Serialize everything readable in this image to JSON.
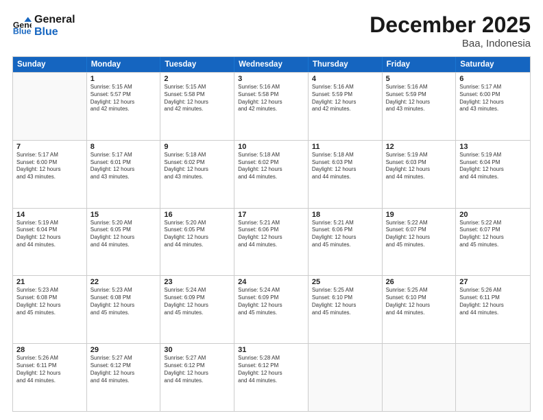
{
  "header": {
    "logo_line1": "General",
    "logo_line2": "Blue",
    "title": "December 2025",
    "subtitle": "Baa, Indonesia"
  },
  "days_of_week": [
    "Sunday",
    "Monday",
    "Tuesday",
    "Wednesday",
    "Thursday",
    "Friday",
    "Saturday"
  ],
  "weeks": [
    [
      {
        "day": "",
        "info": ""
      },
      {
        "day": "1",
        "info": "Sunrise: 5:15 AM\nSunset: 5:57 PM\nDaylight: 12 hours\nand 42 minutes."
      },
      {
        "day": "2",
        "info": "Sunrise: 5:15 AM\nSunset: 5:58 PM\nDaylight: 12 hours\nand 42 minutes."
      },
      {
        "day": "3",
        "info": "Sunrise: 5:16 AM\nSunset: 5:58 PM\nDaylight: 12 hours\nand 42 minutes."
      },
      {
        "day": "4",
        "info": "Sunrise: 5:16 AM\nSunset: 5:59 PM\nDaylight: 12 hours\nand 42 minutes."
      },
      {
        "day": "5",
        "info": "Sunrise: 5:16 AM\nSunset: 5:59 PM\nDaylight: 12 hours\nand 43 minutes."
      },
      {
        "day": "6",
        "info": "Sunrise: 5:17 AM\nSunset: 6:00 PM\nDaylight: 12 hours\nand 43 minutes."
      }
    ],
    [
      {
        "day": "7",
        "info": "Sunrise: 5:17 AM\nSunset: 6:00 PM\nDaylight: 12 hours\nand 43 minutes."
      },
      {
        "day": "8",
        "info": "Sunrise: 5:17 AM\nSunset: 6:01 PM\nDaylight: 12 hours\nand 43 minutes."
      },
      {
        "day": "9",
        "info": "Sunrise: 5:18 AM\nSunset: 6:02 PM\nDaylight: 12 hours\nand 43 minutes."
      },
      {
        "day": "10",
        "info": "Sunrise: 5:18 AM\nSunset: 6:02 PM\nDaylight: 12 hours\nand 44 minutes."
      },
      {
        "day": "11",
        "info": "Sunrise: 5:18 AM\nSunset: 6:03 PM\nDaylight: 12 hours\nand 44 minutes."
      },
      {
        "day": "12",
        "info": "Sunrise: 5:19 AM\nSunset: 6:03 PM\nDaylight: 12 hours\nand 44 minutes."
      },
      {
        "day": "13",
        "info": "Sunrise: 5:19 AM\nSunset: 6:04 PM\nDaylight: 12 hours\nand 44 minutes."
      }
    ],
    [
      {
        "day": "14",
        "info": "Sunrise: 5:19 AM\nSunset: 6:04 PM\nDaylight: 12 hours\nand 44 minutes."
      },
      {
        "day": "15",
        "info": "Sunrise: 5:20 AM\nSunset: 6:05 PM\nDaylight: 12 hours\nand 44 minutes."
      },
      {
        "day": "16",
        "info": "Sunrise: 5:20 AM\nSunset: 6:05 PM\nDaylight: 12 hours\nand 44 minutes."
      },
      {
        "day": "17",
        "info": "Sunrise: 5:21 AM\nSunset: 6:06 PM\nDaylight: 12 hours\nand 44 minutes."
      },
      {
        "day": "18",
        "info": "Sunrise: 5:21 AM\nSunset: 6:06 PM\nDaylight: 12 hours\nand 45 minutes."
      },
      {
        "day": "19",
        "info": "Sunrise: 5:22 AM\nSunset: 6:07 PM\nDaylight: 12 hours\nand 45 minutes."
      },
      {
        "day": "20",
        "info": "Sunrise: 5:22 AM\nSunset: 6:07 PM\nDaylight: 12 hours\nand 45 minutes."
      }
    ],
    [
      {
        "day": "21",
        "info": "Sunrise: 5:23 AM\nSunset: 6:08 PM\nDaylight: 12 hours\nand 45 minutes."
      },
      {
        "day": "22",
        "info": "Sunrise: 5:23 AM\nSunset: 6:08 PM\nDaylight: 12 hours\nand 45 minutes."
      },
      {
        "day": "23",
        "info": "Sunrise: 5:24 AM\nSunset: 6:09 PM\nDaylight: 12 hours\nand 45 minutes."
      },
      {
        "day": "24",
        "info": "Sunrise: 5:24 AM\nSunset: 6:09 PM\nDaylight: 12 hours\nand 45 minutes."
      },
      {
        "day": "25",
        "info": "Sunrise: 5:25 AM\nSunset: 6:10 PM\nDaylight: 12 hours\nand 45 minutes."
      },
      {
        "day": "26",
        "info": "Sunrise: 5:25 AM\nSunset: 6:10 PM\nDaylight: 12 hours\nand 44 minutes."
      },
      {
        "day": "27",
        "info": "Sunrise: 5:26 AM\nSunset: 6:11 PM\nDaylight: 12 hours\nand 44 minutes."
      }
    ],
    [
      {
        "day": "28",
        "info": "Sunrise: 5:26 AM\nSunset: 6:11 PM\nDaylight: 12 hours\nand 44 minutes."
      },
      {
        "day": "29",
        "info": "Sunrise: 5:27 AM\nSunset: 6:12 PM\nDaylight: 12 hours\nand 44 minutes."
      },
      {
        "day": "30",
        "info": "Sunrise: 5:27 AM\nSunset: 6:12 PM\nDaylight: 12 hours\nand 44 minutes."
      },
      {
        "day": "31",
        "info": "Sunrise: 5:28 AM\nSunset: 6:12 PM\nDaylight: 12 hours\nand 44 minutes."
      },
      {
        "day": "",
        "info": ""
      },
      {
        "day": "",
        "info": ""
      },
      {
        "day": "",
        "info": ""
      }
    ]
  ]
}
